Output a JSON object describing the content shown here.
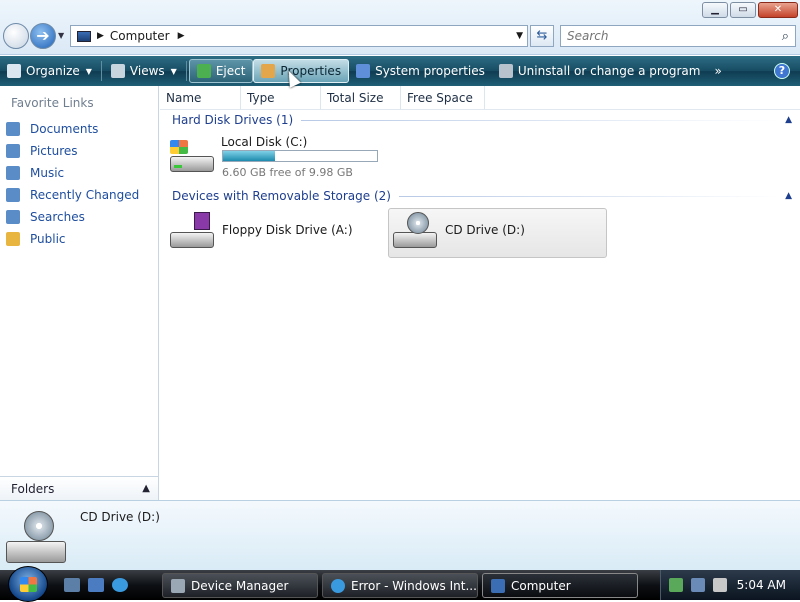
{
  "address": {
    "breadcrumb": "Computer",
    "search_placeholder": "Search"
  },
  "caption": {
    "minimize": "▁",
    "maximize": "▭",
    "close": "✕"
  },
  "toolbar": {
    "organize": "Organize",
    "views": "Views",
    "eject": "Eject",
    "properties": "Properties",
    "system_properties": "System properties",
    "uninstall": "Uninstall or change a program",
    "more": "»",
    "help": "?"
  },
  "sidebar": {
    "title": "Favorite Links",
    "items": [
      {
        "label": "Documents",
        "icon": "documents-icon",
        "color": "#5a8cc8"
      },
      {
        "label": "Pictures",
        "icon": "pictures-icon",
        "color": "#5a8cc8"
      },
      {
        "label": "Music",
        "icon": "music-icon",
        "color": "#5a8cc8"
      },
      {
        "label": "Recently Changed",
        "icon": "recent-icon",
        "color": "#5a8cc8"
      },
      {
        "label": "Searches",
        "icon": "searches-icon",
        "color": "#5a8cc8"
      },
      {
        "label": "Public",
        "icon": "folder-icon",
        "color": "#e8b640"
      }
    ],
    "folders_label": "Folders"
  },
  "columns": [
    "Name",
    "Type",
    "Total Size",
    "Free Space"
  ],
  "groups": {
    "hard_disks": "Hard Disk Drives (1)",
    "removable": "Devices with Removable Storage (2)"
  },
  "drives": {
    "local_disk": {
      "name": "Local Disk (C:)",
      "free_text": "6.60 GB free of 9.98 GB",
      "used_fraction": 0.34
    },
    "floppy": {
      "name": "Floppy Disk Drive (A:)"
    },
    "cd": {
      "name": "CD Drive (D:)"
    }
  },
  "details": {
    "title": "CD Drive (D:)"
  },
  "taskbar": {
    "buttons": [
      {
        "label": "Device Manager"
      },
      {
        "label": "Error - Windows Int..."
      },
      {
        "label": "Computer"
      }
    ],
    "clock": "5:04 AM"
  }
}
